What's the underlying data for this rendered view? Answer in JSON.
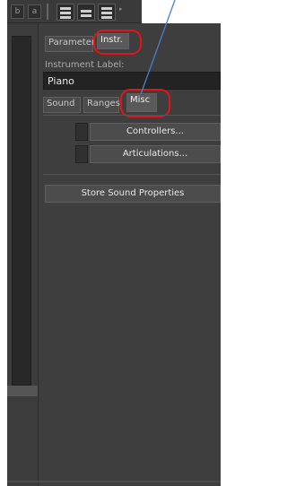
{
  "toolbar": {
    "button_b": "b",
    "button_a": "a",
    "more_glyph": "▸"
  },
  "tabs_top": [
    {
      "label": "Parameter",
      "active": false
    },
    {
      "label": "Instr.",
      "active": true
    }
  ],
  "instrument": {
    "caption": "Instrument Label:",
    "value": "Piano"
  },
  "tabs_sub": [
    {
      "label": "Sound",
      "active": false
    },
    {
      "label": "Ranges",
      "active": false
    },
    {
      "label": "Misc",
      "active": true
    }
  ],
  "misc": {
    "controllers_label": "Controllers...",
    "articulations_label": "Articulations...",
    "store_label": "Store Sound Properties"
  },
  "colors": {
    "highlight_circle": "#e2141a",
    "annotation_line": "#4a7fc4",
    "panel_bg": "#3e3e3e"
  }
}
